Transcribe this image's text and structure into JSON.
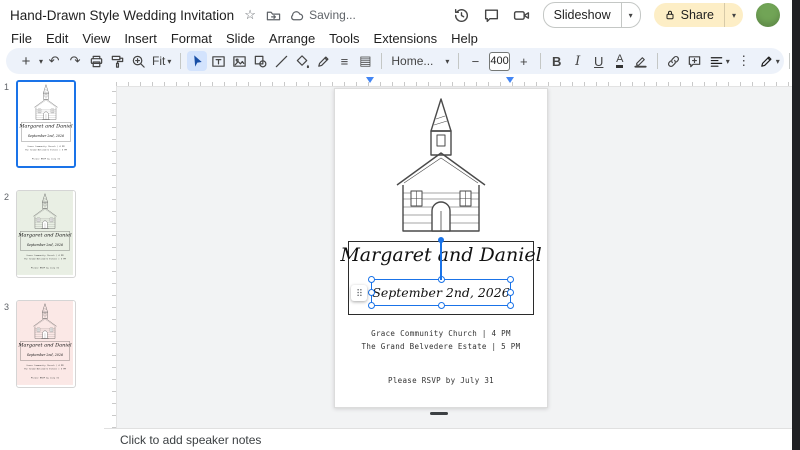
{
  "titlebar": {
    "title": "Hand-Drawn Style Wedding Invitation",
    "saving": "Saving...",
    "slideshow_label": "Slideshow",
    "share_label": "Share"
  },
  "menubar": {
    "items": [
      "File",
      "Edit",
      "View",
      "Insert",
      "Format",
      "Slide",
      "Arrange",
      "Tools",
      "Extensions",
      "Help"
    ]
  },
  "toolbar": {
    "zoom_label": "Fit",
    "font_label": "Home...",
    "font_size": "400",
    "bold": "B",
    "italic": "I",
    "underline": "U",
    "text_color": "A"
  },
  "icons": {
    "plus": "+",
    "minus": "−",
    "undo": "↶",
    "redo": "↷",
    "caret_down": "▾",
    "collapse_up": "▴",
    "star": "☆",
    "more_vertical": "⋮",
    "border_weight": "≡",
    "border_dash": "▤"
  },
  "filmstrip": {
    "slide_numbers": [
      "1",
      "2",
      "3"
    ]
  },
  "slide": {
    "names": "Margaret and Daniel",
    "date": "September 2nd, 2026",
    "venue_line1": "Grace Community Church | 4 PM",
    "venue_line2": "The Grand Belvedere Estate | 5 PM",
    "rsvp": "Please RSVP by July 31"
  },
  "notes": {
    "placeholder": "Click to add speaker notes"
  },
  "colors": {
    "accent": "#1a73e8",
    "toolbar_bg": "#edf2fa",
    "share_button_bg": "#fdeec6",
    "slide2_bg": "#e9efe4",
    "slide3_bg": "#fbe8e6",
    "canvas_bg": "#f2f3f4"
  }
}
